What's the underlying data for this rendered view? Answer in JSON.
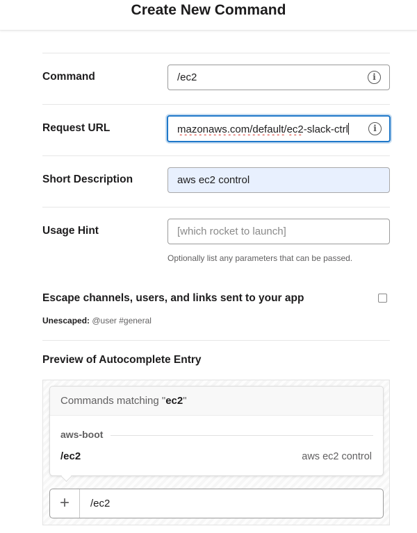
{
  "header": {
    "title": "Create New Command"
  },
  "form": {
    "command": {
      "label": "Command",
      "value": "/ec2"
    },
    "request_url": {
      "label": "Request URL",
      "value_prefix": "mazonaws.com/default/",
      "value_word": "ec2",
      "value_suffix": "-slack-ctrl"
    },
    "short_description": {
      "label": "Short Description",
      "value": "aws ec2 control"
    },
    "usage_hint": {
      "label": "Usage Hint",
      "placeholder": "[which rocket to launch]",
      "help": "Optionally list any parameters that can be passed."
    },
    "info_icon_glyph": "i"
  },
  "escape": {
    "label": "Escape channels, users, and links sent to your app",
    "checked": false,
    "note_label": "Unescaped:",
    "note_value": "@user #general"
  },
  "preview": {
    "title": "Preview of Autocomplete Entry",
    "matching_prefix": "Commands matching \"",
    "matching_term": "ec2",
    "matching_suffix": "\"",
    "app_name": "aws-boot",
    "command": "/ec2",
    "description": "aws ec2 control",
    "plus_glyph": "+",
    "message_text": "/ec2"
  },
  "colors": {
    "focus_border": "#1f78c9",
    "autofill_bg": "#e8f0fe",
    "spell_error": "#d93025"
  }
}
